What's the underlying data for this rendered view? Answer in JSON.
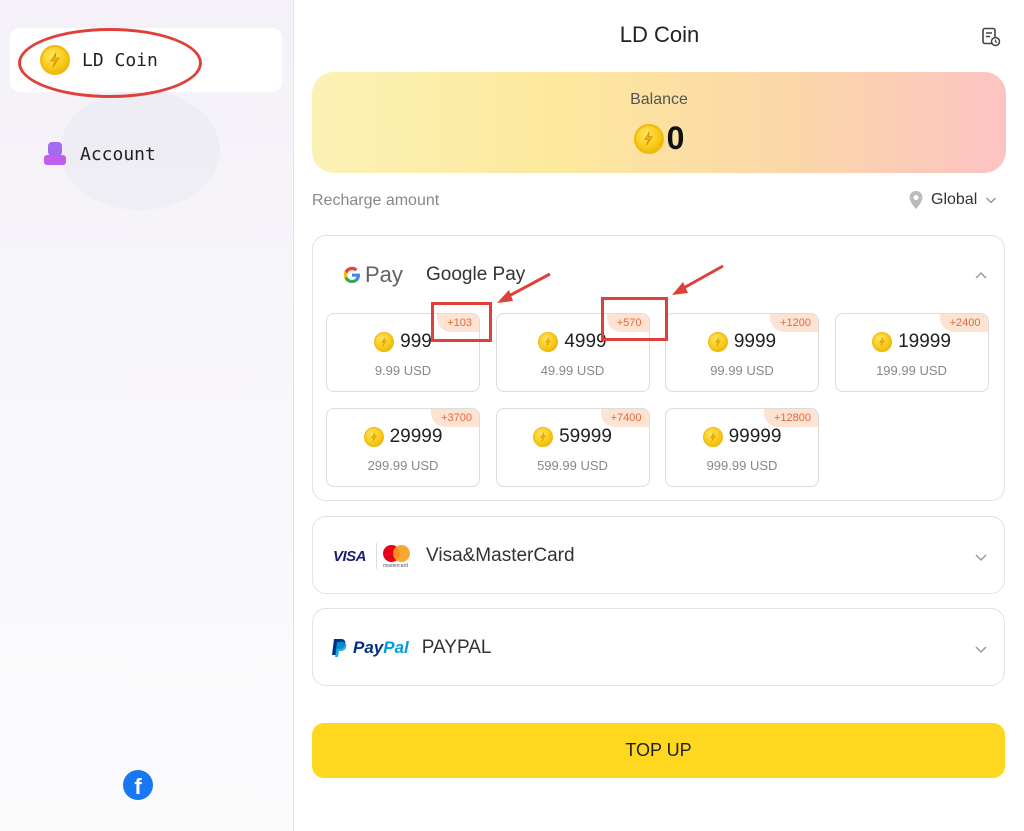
{
  "sidebar": {
    "items": [
      {
        "label": "LD Coin",
        "icon": "coin-icon",
        "active": true
      },
      {
        "label": "Account",
        "icon": "account-icon",
        "active": false
      }
    ],
    "footer_icon": "facebook-icon"
  },
  "header": {
    "title": "LD Coin",
    "history_icon": "order-history-icon"
  },
  "balance": {
    "label": "Balance",
    "value": "0"
  },
  "recharge": {
    "label": "Recharge amount",
    "region": "Global"
  },
  "google_pay": {
    "logo_text": "Pay",
    "name": "Google Pay",
    "expanded": true,
    "options": [
      {
        "amount": "999",
        "price": "9.99 USD",
        "bonus": "+103"
      },
      {
        "amount": "4999",
        "price": "49.99 USD",
        "bonus": "+570"
      },
      {
        "amount": "9999",
        "price": "99.99 USD",
        "bonus": "+1200"
      },
      {
        "amount": "19999",
        "price": "199.99 USD",
        "bonus": "+2400"
      },
      {
        "amount": "29999",
        "price": "299.99 USD",
        "bonus": "+3700"
      },
      {
        "amount": "59999",
        "price": "599.99 USD",
        "bonus": "+7400"
      },
      {
        "amount": "99999",
        "price": "999.99 USD",
        "bonus": "+12800"
      }
    ]
  },
  "visa_master": {
    "visa_logo": "VISA",
    "mc_logo": "mastercard",
    "name": "Visa&MasterCard"
  },
  "paypal": {
    "logo_a": "Pay",
    "logo_b": "Pal",
    "name": "PAYPAL"
  },
  "button": {
    "label": "TOP UP"
  },
  "colors": {
    "accent": "#fed71f",
    "annotation": "#e0403a",
    "bonus": "#e46a3a"
  }
}
